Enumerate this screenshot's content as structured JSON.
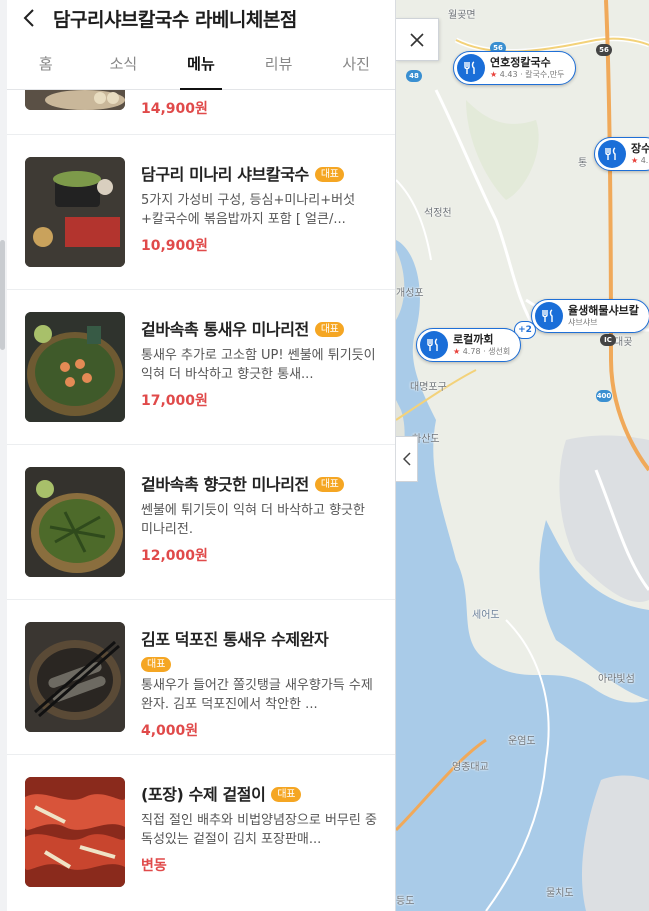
{
  "header": {
    "store_name": "담구리샤브칼국수 라베니체본점"
  },
  "tabs": [
    {
      "label": "홈"
    },
    {
      "label": "소식"
    },
    {
      "label": "메뉴"
    },
    {
      "label": "리뷰"
    },
    {
      "label": "사진"
    }
  ],
  "active_tab": "메뉴",
  "menu": {
    "top_partial_price": "14,900원",
    "items": [
      {
        "name": "담구리 미나리 샤브칼국수",
        "tag": "대표",
        "desc": "5가지 가성비 구성, 등심+미나리+버섯+칼국수에 볶음밥까지 포함 [ 얼큰/...",
        "price": "10,900원"
      },
      {
        "name": "겉바속촉 통새우 미나리전",
        "tag": "대표",
        "desc": "통새우 추가로 고소함 UP! 쎈불에 튀기듯이 익혀 더 바삭하고 향긋한 통새...",
        "price": "17,000원"
      },
      {
        "name": "겉바속촉 향긋한 미나리전",
        "tag": "대표",
        "desc": "쎈불에 튀기듯이 익혀 더 바삭하고 향긋한 미나리전.",
        "price": "12,000원"
      },
      {
        "name": "김포 덕포진 통새우 수제완자",
        "tag": "대표",
        "desc": "통새우가 들어간 쫄깃탱글 새우향가득 수제완자. 김포 덕포진에서 착안한 ...",
        "price": "4,000원"
      },
      {
        "name": "(포장) 수제 겉절이",
        "tag": "대표",
        "desc": "직접 절인 배추와 비법양념장으로 버무린 중독성있는 겉절이 김치 포장판매...",
        "price": "변동"
      }
    ]
  },
  "map": {
    "labels": {
      "wolgot": "월곶면",
      "tong": "통",
      "seokjeong": "석정천",
      "gaeseong": "개성포",
      "daemyeong": "대명포구",
      "hasando": "하산도",
      "daegok": "대곶",
      "seeodo": "세어도",
      "unyeomdo": "운염도",
      "yeongjong_bridge": "영종대교",
      "arabit": "아라빛섬",
      "mulchido": "물치도",
      "ando": "등도"
    },
    "roads": {
      "r56": "56",
      "r56b": "56",
      "r48": "48",
      "r400": "400",
      "ic": "IC"
    },
    "markers": [
      {
        "name": "연호정칼국수",
        "rating": "4.43",
        "sub": "칼국수,만두"
      },
      {
        "name": "장수",
        "rating": "4.",
        "sub": ""
      },
      {
        "name": "율생해물샤브칼",
        "rating": "",
        "sub": "샤브샤브"
      },
      {
        "name": "로컬까회",
        "rating": "4.78",
        "sub": "생선회"
      }
    ],
    "cluster_badge": "+2"
  }
}
